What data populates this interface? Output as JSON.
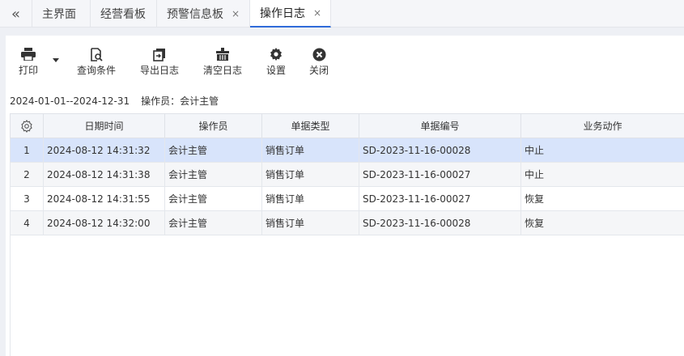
{
  "tabs": [
    {
      "label": "主界面",
      "closable": false,
      "active": false
    },
    {
      "label": "经营看板",
      "closable": false,
      "active": false
    },
    {
      "label": "预警信息板",
      "closable": true,
      "active": false
    },
    {
      "label": "操作日志",
      "closable": true,
      "active": true
    }
  ],
  "tab_close_glyph": "×",
  "toolbar": {
    "print": "打印",
    "query": "查询条件",
    "export": "导出日志",
    "clear": "清空日志",
    "settings": "设置",
    "close": "关闭"
  },
  "filter": {
    "date_range": "2024-01-01--2024-12-31",
    "operator_label": "操作员：",
    "operator_value": "会计主管"
  },
  "table": {
    "columns": [
      "日期时间",
      "操作员",
      "单据类型",
      "单据编号",
      "业务动作"
    ],
    "rows": [
      {
        "idx": "1",
        "datetime": "2024-08-12 14:31:32",
        "operator": "会计主管",
        "doc_type": "销售订单",
        "doc_no": "SD-2023-11-16-00028",
        "action": "中止"
      },
      {
        "idx": "2",
        "datetime": "2024-08-12 14:31:38",
        "operator": "会计主管",
        "doc_type": "销售订单",
        "doc_no": "SD-2023-11-16-00027",
        "action": "中止"
      },
      {
        "idx": "3",
        "datetime": "2024-08-12 14:31:55",
        "operator": "会计主管",
        "doc_type": "销售订单",
        "doc_no": "SD-2023-11-16-00027",
        "action": "恢复"
      },
      {
        "idx": "4",
        "datetime": "2024-08-12 14:32:00",
        "operator": "会计主管",
        "doc_type": "销售订单",
        "doc_no": "SD-2023-11-16-00028",
        "action": "恢复"
      }
    ]
  },
  "colors": {
    "accent": "#2f6bd9",
    "selected_row": "#d8e4fb",
    "header_bg": "#f3f5f9"
  }
}
